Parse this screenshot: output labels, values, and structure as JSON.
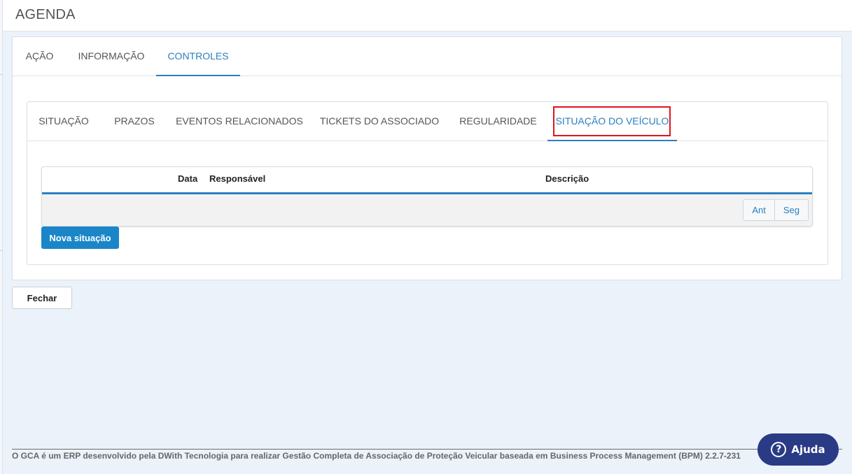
{
  "header": {
    "title": "AGENDA"
  },
  "main_tabs": [
    {
      "label": "AÇÃO",
      "active": false
    },
    {
      "label": "INFORMAÇÃO",
      "active": false
    },
    {
      "label": "CONTROLES",
      "active": true
    }
  ],
  "sub_tabs": [
    {
      "label": "SITUAÇÃO",
      "active": false
    },
    {
      "label": "PRAZOS",
      "active": false
    },
    {
      "label": "EVENTOS RELACIONADOS",
      "active": false
    },
    {
      "label": "TICKETS DO ASSOCIADO",
      "active": false
    },
    {
      "label": "REGULARIDADE",
      "active": false
    },
    {
      "label": "SITUAÇÃO DO VEÍCULO",
      "active": true
    }
  ],
  "table": {
    "columns": [
      "Data",
      "Responsável",
      "Descrição"
    ],
    "rows": []
  },
  "pager": {
    "prev_label": "Ant",
    "next_label": "Seg"
  },
  "actions": {
    "new_situation_label": "Nova situação",
    "close_label": "Fechar"
  },
  "footer": {
    "text": "O GCA é um ERP desenvolvido pela DWith Tecnologia para realizar Gestão Completa de Associação de Proteção Veicular baseada em Business Process Management (BPM) 2.2.7-231"
  },
  "help": {
    "label": "Ajuda",
    "icon": "question-icon"
  },
  "colors": {
    "accent": "#2a7fc0",
    "primary_button": "#1a86c8",
    "help_button": "#2a3b86",
    "highlight": "#e0151b"
  }
}
